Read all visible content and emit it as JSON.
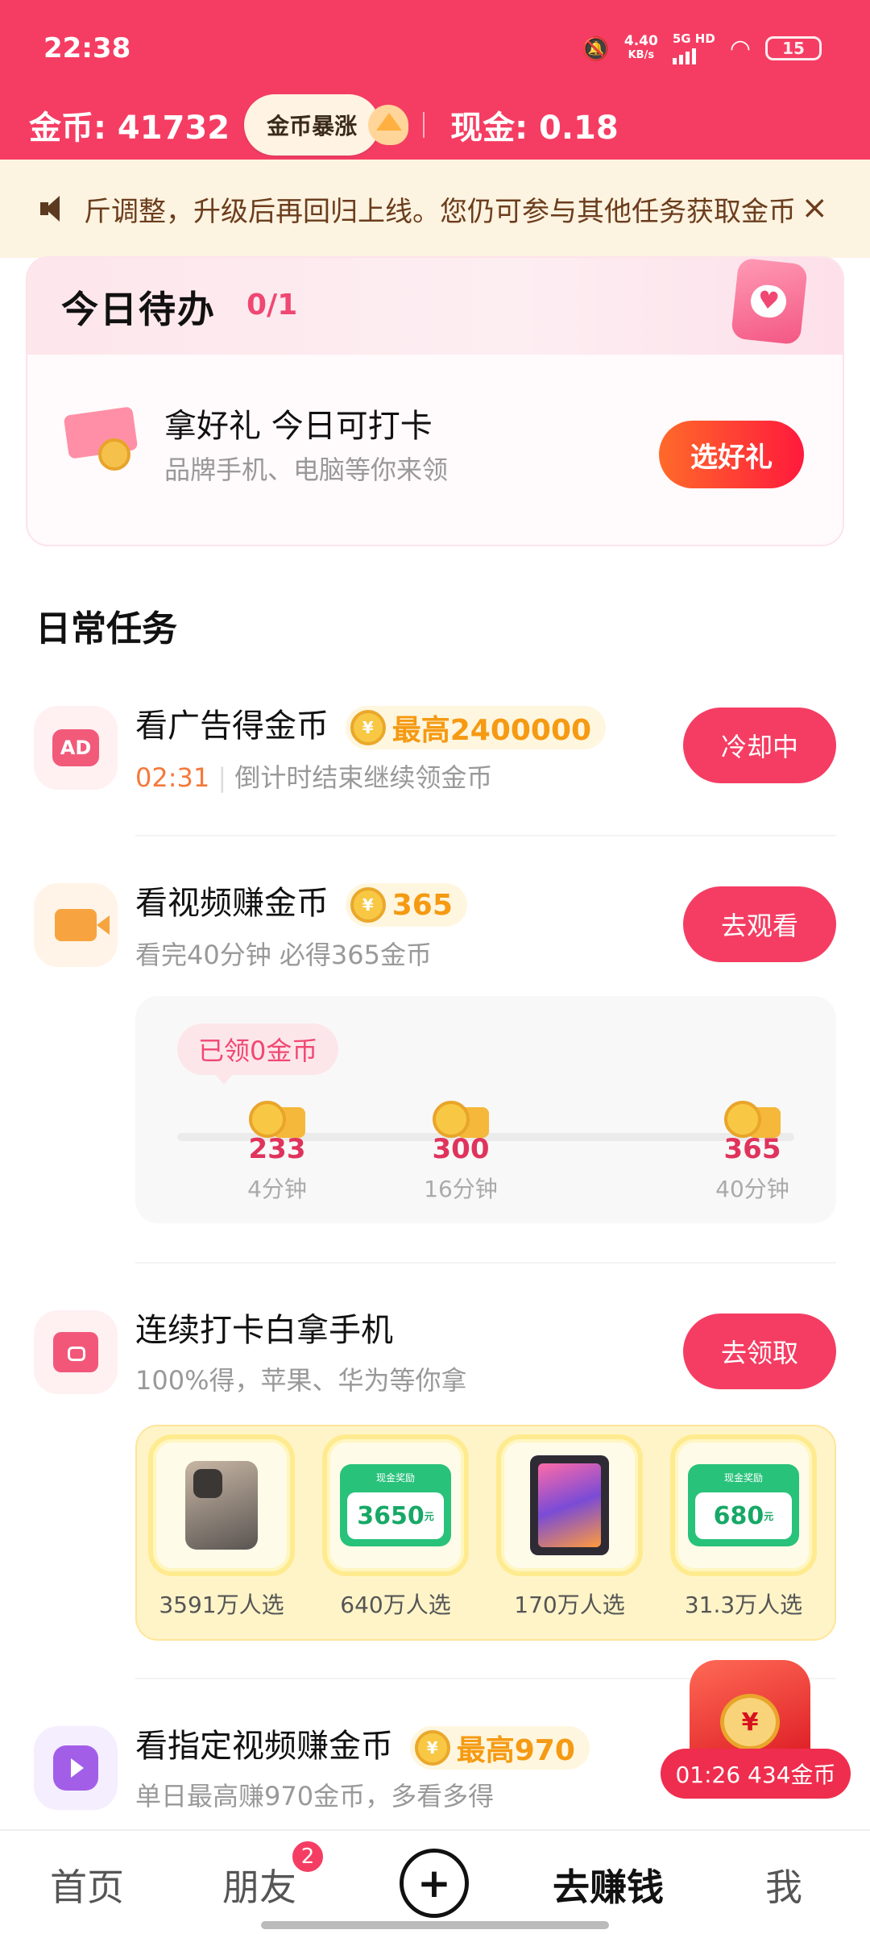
{
  "status_bar": {
    "time": "22:38",
    "net_speed": "4.40",
    "net_unit": "KB/s",
    "network": "5G HD",
    "battery": "15"
  },
  "header": {
    "coins_label": "金币: 41732",
    "boom_label": "金币暴涨",
    "cash_label": "现金: 0.18"
  },
  "notice": {
    "text": "斤调整，升级后再回归上线。您仍可参与其他任务获取金币",
    "close": "×"
  },
  "todo": {
    "title": "今日待办",
    "count": "0/1",
    "calendar_glyph": "♥",
    "main": "拿好礼 今日可打卡",
    "sub": "品牌手机、电脑等你来领",
    "button": "选好礼"
  },
  "section_title": "日常任务",
  "tasks": [
    {
      "icon": "ad-icon",
      "icon_text": "AD",
      "title": "看广告得金币",
      "reward": "最高2400000",
      "sub_countdown": "02:31",
      "sub": "倒计时结束继续领金币",
      "button": "冷却中"
    },
    {
      "icon": "video-icon",
      "title": "看视频赚金币",
      "reward": "365",
      "sub": "看完40分钟 必得365金币",
      "button": "去观看"
    },
    {
      "icon": "bag-icon",
      "title": "连续打卡白拿手机",
      "sub": "100%得，苹果、华为等你拿",
      "button": "去领取"
    },
    {
      "icon": "play-icon",
      "title": "看指定视频赚金币",
      "reward": "最高970",
      "sub": "单日最高赚970金币，多看多得"
    }
  ],
  "video_progress": {
    "claimed": "已领0金币",
    "milestones": [
      {
        "value": "233",
        "time": "4分钟"
      },
      {
        "value": "300",
        "time": "16分钟"
      },
      {
        "value": "365",
        "time": "40分钟"
      }
    ]
  },
  "prizes": [
    {
      "type": "phone",
      "label": "3591万人选"
    },
    {
      "type": "cash",
      "head": "现金奖励",
      "amount": "3650",
      "unit": "元",
      "label": "640万人选"
    },
    {
      "type": "tablet",
      "label": "170万人选"
    },
    {
      "type": "cash",
      "head": "现金奖励",
      "amount": "680",
      "unit": "元",
      "label": "31.3万人选"
    }
  ],
  "floating": {
    "medal": "¥",
    "timer": "01:26 434金币"
  },
  "coin_glyph": "¥",
  "bottom_nav": {
    "home": "首页",
    "friends": "朋友",
    "friends_badge": "2",
    "plus": "+",
    "earn": "去赚钱",
    "me": "我"
  }
}
